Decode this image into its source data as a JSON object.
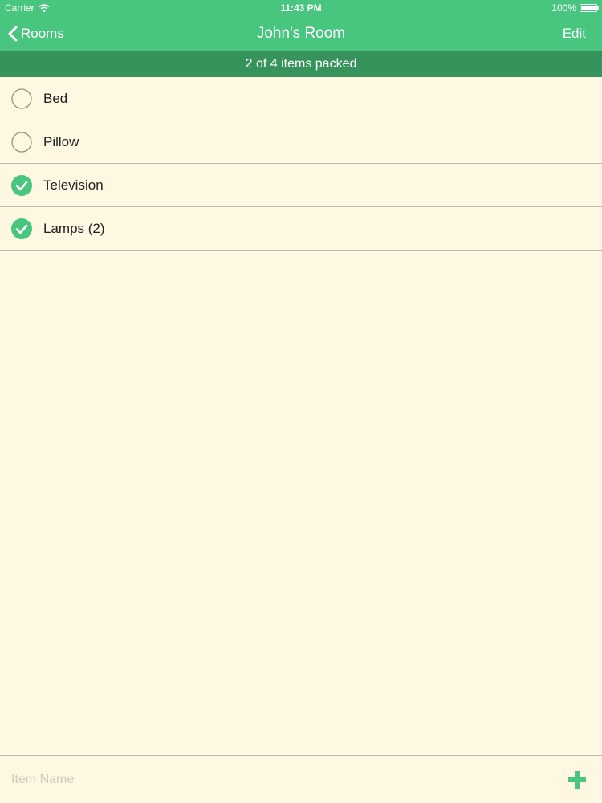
{
  "statusbar": {
    "carrier": "Carrier",
    "time": "11:43 PM",
    "battery": "100%"
  },
  "navbar": {
    "back_label": "Rooms",
    "title": "John's Room",
    "edit_label": "Edit"
  },
  "summary": "2 of 4 items packed",
  "items": [
    {
      "label": "Bed",
      "packed": false
    },
    {
      "label": "Pillow",
      "packed": false
    },
    {
      "label": "Television",
      "packed": true
    },
    {
      "label": "Lamps (2)",
      "packed": true
    }
  ],
  "footer": {
    "placeholder": "Item Name"
  },
  "colors": {
    "accent": "#48c57e",
    "accent_dark": "#36935c",
    "background": "#fef7e2",
    "separator": "#bdb9ad",
    "unchecked_ring": "#9a8f7f"
  }
}
